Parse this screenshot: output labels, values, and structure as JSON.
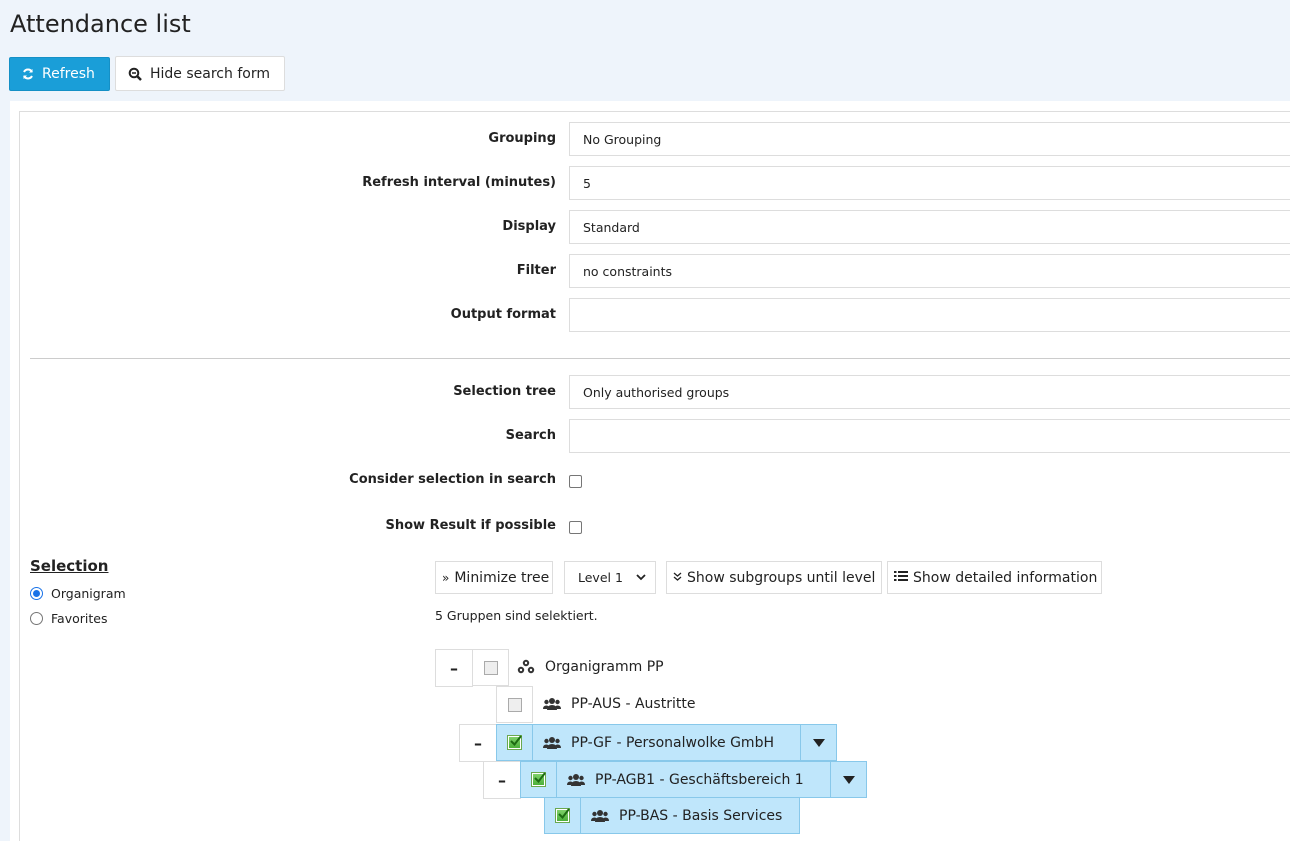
{
  "page": {
    "title": "Attendance list"
  },
  "toolbar": {
    "refresh_label": "Refresh",
    "hide_search_label": "Hide search form"
  },
  "form": {
    "grouping": {
      "label": "Grouping",
      "value": "No Grouping"
    },
    "refresh_interval": {
      "label": "Refresh interval (minutes)",
      "value": "5"
    },
    "display": {
      "label": "Display",
      "value": "Standard"
    },
    "filter": {
      "label": "Filter",
      "value": "no constraints"
    },
    "output_format": {
      "label": "Output format",
      "value": ""
    },
    "selection_tree": {
      "label": "Selection tree",
      "value": "Only authorised groups"
    },
    "search": {
      "label": "Search",
      "value": ""
    },
    "consider_selection": {
      "label": "Consider selection in search",
      "checked": false
    },
    "show_result": {
      "label": "Show Result if possible",
      "checked": false
    }
  },
  "selection": {
    "title": "Selection",
    "options": [
      {
        "label": "Organigram",
        "checked": true
      },
      {
        "label": "Favorites",
        "checked": false
      }
    ]
  },
  "tree_toolbar": {
    "minimize_label": "Minimize tree",
    "level_value": "Level 1",
    "show_subgroups_label": "Show subgroups until level",
    "show_details_label": "Show detailed information",
    "status": "5 Gruppen sind selektiert."
  },
  "tree": {
    "nodes": [
      {
        "label": "Organigramm PP",
        "selected": false,
        "toggle": "–"
      },
      {
        "label": "PP-AUS - Austritte",
        "selected": false,
        "toggle": ""
      },
      {
        "label": "PP-GF - Personalwolke GmbH",
        "selected": true,
        "toggle": "–"
      },
      {
        "label": "PP-AGB1 - Geschäftsbereich 1",
        "selected": true,
        "toggle": "–"
      },
      {
        "label": "PP-BAS - Basis Services",
        "selected": true,
        "toggle": ""
      }
    ]
  },
  "colors": {
    "primary": "#1a9ed8",
    "selected_bg": "#bfe6fb",
    "page_bg": "#eef4fb"
  }
}
